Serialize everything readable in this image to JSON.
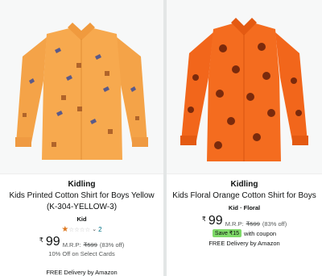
{
  "products": [
    {
      "brand": "Kidling",
      "title": "Kids Printed Cotton Shirt for Boys Yellow (K-304-YELLOW-3)",
      "subtitle": "Kid",
      "rating_count": "2",
      "price_symbol": "₹",
      "price": "99",
      "mrp_label": "M.R.P:",
      "mrp_value": "₹599",
      "discount": "(83% off)",
      "offer": "10% Off on Select Cards",
      "delivery": "FREE Delivery by Amazon",
      "rating": 1.5,
      "shirt_color": "#f5a64a"
    },
    {
      "brand": "Kidling",
      "title": "Kids Floral Orange Cotton Shirt for Boys",
      "subtitle": "Kid · Floral",
      "price_symbol": "₹",
      "price": "99",
      "mrp_label": "M.R.P:",
      "mrp_value": "₹599",
      "discount": "(83% off)",
      "coupon_save": "Save ₹15",
      "coupon_label": "with coupon",
      "delivery": "FREE Delivery by Amazon",
      "shirt_color": "#f06a1e"
    }
  ]
}
